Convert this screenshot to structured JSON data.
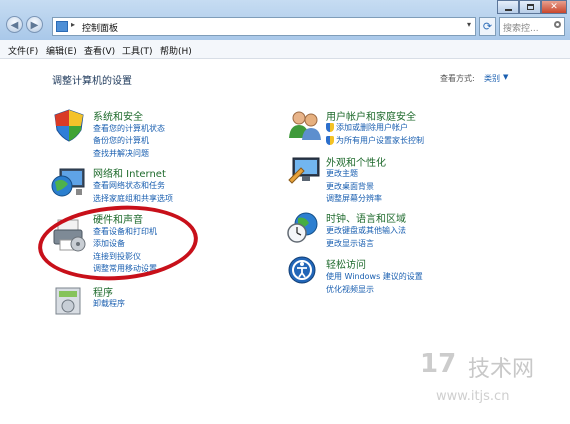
{
  "window": {
    "address": "控制面板",
    "search_placeholder": "搜索控..."
  },
  "menu": [
    "文件(F)",
    "编辑(E)",
    "查看(V)",
    "工具(T)",
    "帮助(H)"
  ],
  "main": {
    "heading": "调整计算机的设置",
    "view_by_label": "查看方式:",
    "view_by_value": "类别"
  },
  "categories": {
    "system": {
      "title": "系统和安全",
      "links": [
        "查看您的计算机状态",
        "备份您的计算机",
        "查找并解决问题"
      ]
    },
    "network": {
      "title": "网络和 Internet",
      "links": [
        "查看网络状态和任务",
        "选择家庭组和共享选项"
      ]
    },
    "hardware": {
      "title": "硬件和声音",
      "links": [
        "查看设备和打印机",
        "添加设备",
        "连接到投影仪",
        "调整常用移动设置"
      ]
    },
    "programs": {
      "title": "程序",
      "links": [
        "卸载程序"
      ]
    },
    "accounts": {
      "title": "用户帐户和家庭安全",
      "links": [
        "添加或删除用户帐户",
        "为所有用户设置家长控制"
      ]
    },
    "appearance": {
      "title": "外观和个性化",
      "links": [
        "更改主题",
        "更改桌面背景",
        "调整屏幕分辨率"
      ]
    },
    "clock": {
      "title": "时钟、语言和区域",
      "links": [
        "更改键盘或其他输入法",
        "更改显示语言"
      ]
    },
    "ease": {
      "title": "轻松访问",
      "links": [
        "使用 Windows 建议的设置",
        "优化视频显示"
      ]
    }
  },
  "watermark": {
    "logo": "17",
    "name": "技术网",
    "url": "www.itjs.cn"
  },
  "colors": {
    "category_title": "#1e6a2c",
    "link": "#1a5fb0",
    "highlight_circle": "#c8101a"
  }
}
